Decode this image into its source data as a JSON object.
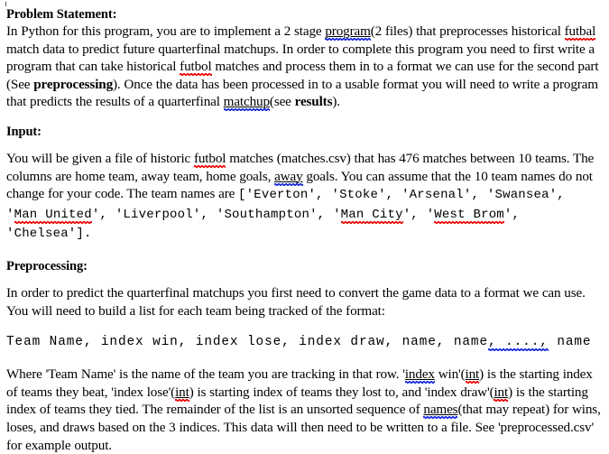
{
  "document": {
    "type": "assignment-specification",
    "sections": [
      {
        "id": "problem-statement",
        "heading": "Problem Statement:",
        "body_runs": [
          {
            "text": "In Python for this program, you are to implement a 2 stage ",
            "style": "normal"
          },
          {
            "text": "program",
            "style": "grammar-error"
          },
          {
            "text": "(2 files) that preprocesses historical ",
            "style": "normal"
          },
          {
            "text": "futbal",
            "style": "spelling-error"
          },
          {
            "text": " match data to predict future quarterfinal matchups.  In order to complete this program you need to first write a program that can take historical ",
            "style": "normal"
          },
          {
            "text": "futbol",
            "style": "spelling-error"
          },
          {
            "text": " matches and process them in to a format we can use for the second part (See ",
            "style": "normal"
          },
          {
            "text": "preprocessing",
            "style": "bold"
          },
          {
            "text": ").  Once the data has been processed in to a usable format you will need to write a program that predicts the results of a quarterfinal ",
            "style": "normal"
          },
          {
            "text": "matchup",
            "style": "grammar-error"
          },
          {
            "text": "(see ",
            "style": "normal"
          },
          {
            "text": "results",
            "style": "bold"
          },
          {
            "text": ").",
            "style": "normal"
          }
        ]
      },
      {
        "id": "input",
        "heading": "Input:",
        "body_runs": [
          {
            "text": "You will be given a file of historic ",
            "style": "normal"
          },
          {
            "text": "futbol",
            "style": "spelling-error"
          },
          {
            "text": " matches (matches.csv) that has 476 matches between 10 teams.  The columns are home team, away team, home goals, ",
            "style": "normal"
          },
          {
            "text": "away",
            "style": "grammar-error"
          },
          {
            "text": " goals.  You can assume that the 10 team names do not change for your code.  The team names are ",
            "style": "normal"
          },
          {
            "text": "['Everton', 'Stoke', 'Arsenal', 'Swansea', '",
            "style": "mono"
          },
          {
            "text": "Man United",
            "style": "mono-spelling-error"
          },
          {
            "text": "', 'Liverpool', 'Southampton', '",
            "style": "mono"
          },
          {
            "text": "Man City",
            "style": "mono-spelling-error"
          },
          {
            "text": "', '",
            "style": "mono"
          },
          {
            "text": "West Brom",
            "style": "mono-spelling-error"
          },
          {
            "text": "', 'Chelsea'].",
            "style": "mono"
          }
        ]
      },
      {
        "id": "preprocessing",
        "heading": "Preprocessing:",
        "body_runs": [
          {
            "text": "In order to predict the quarterfinal matchups you first need to convert the game data to a format we can use.  You will need to build a list for each team being tracked of the format:",
            "style": "normal"
          }
        ]
      }
    ],
    "format_line": {
      "id": "record-format",
      "prefix": "Team Name, index win, index lose, index draw, name, name",
      "grammar_marked": ", ....,",
      "suffix": " name"
    },
    "closing_paragraph": {
      "id": "format-explanation",
      "runs": [
        {
          "text": "Where 'Team Name' is the name of the team you are tracking in that row.  '",
          "style": "normal"
        },
        {
          "text": "index",
          "style": "grammar-error"
        },
        {
          "text": " win'(",
          "style": "normal"
        },
        {
          "text": "int",
          "style": "spelling-error"
        },
        {
          "text": ") is the starting index of teams they beat, 'index lose'(",
          "style": "normal"
        },
        {
          "text": "int",
          "style": "spelling-error"
        },
        {
          "text": ") is starting index of teams they lost to, and 'index draw'(",
          "style": "normal"
        },
        {
          "text": "int",
          "style": "spelling-error"
        },
        {
          "text": ") is the starting index of teams they tied.  The remainder of the list is an unsorted sequence of ",
          "style": "normal"
        },
        {
          "text": "names",
          "style": "grammar-error"
        },
        {
          "text": "(that may repeat) for wins, loses, and draws based on the 3 indices.  This data will then need to be written to a file.  See 'preprocessed.csv' for example output.",
          "style": "normal"
        }
      ]
    },
    "colors": {
      "spelling_error_underline": "#ee1111",
      "grammar_error_underline": "#2233dd",
      "text": "#000000",
      "background": "#ffffff"
    },
    "headings": {
      "problem_statement": "Problem Statement:",
      "input": "Input:",
      "preprocessing": "Preprocessing:"
    },
    "plain_text": {
      "problem_statement_body": "In Python for this program, you are to implement a 2 stage program(2 files) that preprocesses historical futbal match data to predict future quarterfinal matchups.  In order to complete this program you need to first write a program that can take historical futbol matches and process them in to a format we can use for the second part (See preprocessing).  Once the data has been processed in to a usable format you will need to write a program that predicts the results of a quarterfinal matchup(see results).",
      "input_body": "You will be given a file of historic futbol matches (matches.csv) that has 476 matches between 10 teams.  The columns are home team, away team, home goals, away goals.  You can assume that the 10 team names do not change for your code.  The team names are ['Everton', 'Stoke', 'Arsenal', 'Swansea', 'Man United', 'Liverpool', 'Southampton', 'Man City', 'West Brom', 'Chelsea'].",
      "preprocessing_body": "In order to predict the quarterfinal matchups you first need to convert the game data to a format we can use.  You will need to build a list for each team being tracked of the format:",
      "format_line": "Team Name, index win, index lose, index draw, name, name, ...., name",
      "closing_body": "Where 'Team Name' is the name of the team you are tracking in that row.  'index win'(int) is the starting index of teams they beat, 'index lose'(int) is starting index of teams they lost to, and 'index draw'(int) is the starting index of teams they tied.  The remainder of the list is an unsorted sequence of names(that may repeat) for wins, loses, and draws based on the 3 indices.  This data will then need to be written to a file.  See 'preprocessed.csv' for example output."
    },
    "teams": [
      "Everton",
      "Stoke",
      "Arsenal",
      "Swansea",
      "Man United",
      "Liverpool",
      "Southampton",
      "Man City",
      "West Brom",
      "Chelsea"
    ],
    "stats": {
      "match_count": "476",
      "team_count": "10",
      "stage_count": "2",
      "file_count": "2",
      "index_count": "3"
    },
    "files": {
      "input_csv": "matches.csv",
      "output_csv": "preprocessed.csv"
    }
  }
}
